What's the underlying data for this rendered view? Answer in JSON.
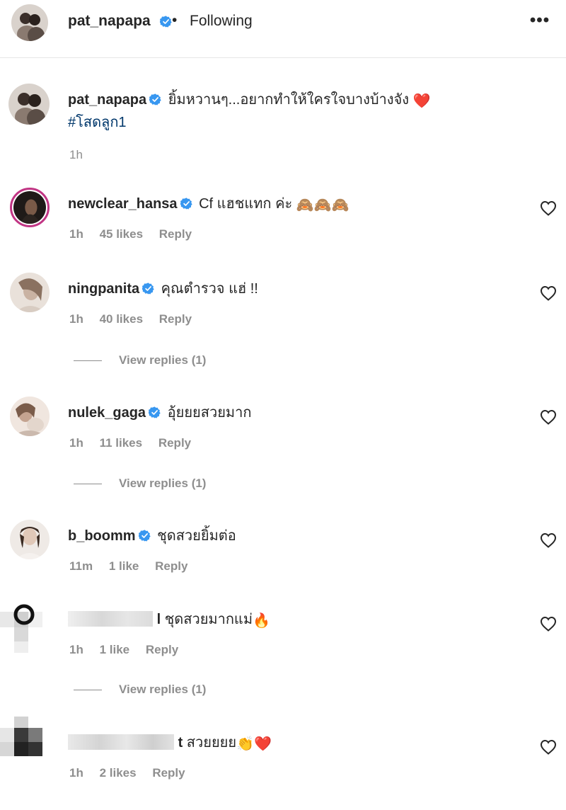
{
  "header": {
    "username": "pat_napapa",
    "separator": "•",
    "follow_status": "Following",
    "more_icon": "•••"
  },
  "caption": {
    "username": "pat_napapa",
    "text": "ยิ้มหวานๆ...อยากทำให้ใครใจบางบ้างจัง",
    "emoji": "❤️",
    "hashtag": "#โสดลูก1",
    "time": "1h"
  },
  "comments": [
    {
      "username": "newclear_hansa",
      "text": "Cf แฮชแทก ค่ะ",
      "emoji": "🙈🙈🙈",
      "time": "1h",
      "likes": "45 likes",
      "reply": "Reply"
    },
    {
      "username": "ningpanita",
      "text": "คุณตำรวจ แฮ่ !!",
      "emoji": "",
      "time": "1h",
      "likes": "40 likes",
      "reply": "Reply",
      "view_replies": "View replies (1)"
    },
    {
      "username": "nulek_gaga",
      "text": "อุ้ยยยสวยมาก",
      "emoji": "",
      "time": "1h",
      "likes": "11 likes",
      "reply": "Reply",
      "view_replies": "View replies (1)"
    },
    {
      "username": "b_boomm",
      "text": "ชุดสวยยิ้มต่อ",
      "emoji": "",
      "time": "11m",
      "likes": "1 like",
      "reply": "Reply"
    },
    {
      "username": "l",
      "text": "ชุดสวยมากแม่",
      "emoji": "🔥",
      "time": "1h",
      "likes": "1 like",
      "reply": "Reply",
      "view_replies": "View replies (1)"
    },
    {
      "username": "t",
      "text": "สวยยยย",
      "emoji": "👏❤️",
      "time": "1h",
      "likes": "2 likes",
      "reply": "Reply"
    }
  ],
  "colors": {
    "text": "#262626",
    "secondary": "#8e8e8e",
    "verified": "#3897f0",
    "hashtag": "#00376b",
    "divider": "#e6e6e6"
  }
}
